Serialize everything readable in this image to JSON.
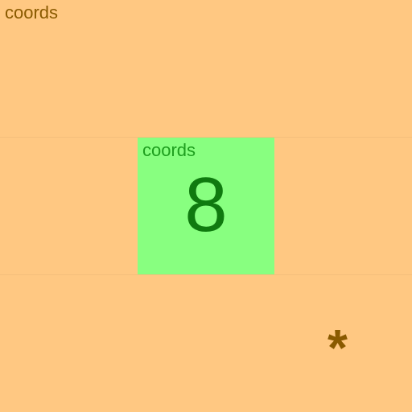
{
  "page": {
    "label": "coords"
  },
  "tile": {
    "label": "coords",
    "number": "8"
  },
  "marker": {
    "glyph": "*",
    "icon": "asterisk-icon"
  },
  "colors": {
    "background": "#ffc882",
    "tile": "#88ff80",
    "page_text": "#8a5a00",
    "tile_label": "#1e9e1e",
    "tile_number": "#0f7a0f"
  }
}
